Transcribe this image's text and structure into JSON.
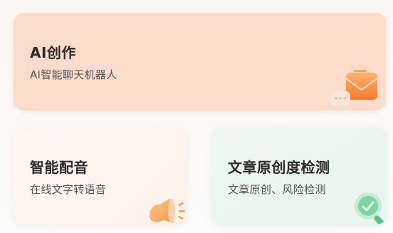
{
  "cards": {
    "ai_creation": {
      "title": "AI创作",
      "subtitle": "AI智能聊天机器人",
      "icon": "envelope-chat-icon",
      "accent": "#f58a3c"
    },
    "voice_dubbing": {
      "title": "智能配音",
      "subtitle": "在线文字转语音",
      "icon": "megaphone-icon",
      "accent": "#f7a85b"
    },
    "originality_check": {
      "title": "文章原创度检测",
      "subtitle": "文章原创、风险检测",
      "icon": "magnifier-check-icon",
      "accent": "#4cc48a"
    }
  }
}
